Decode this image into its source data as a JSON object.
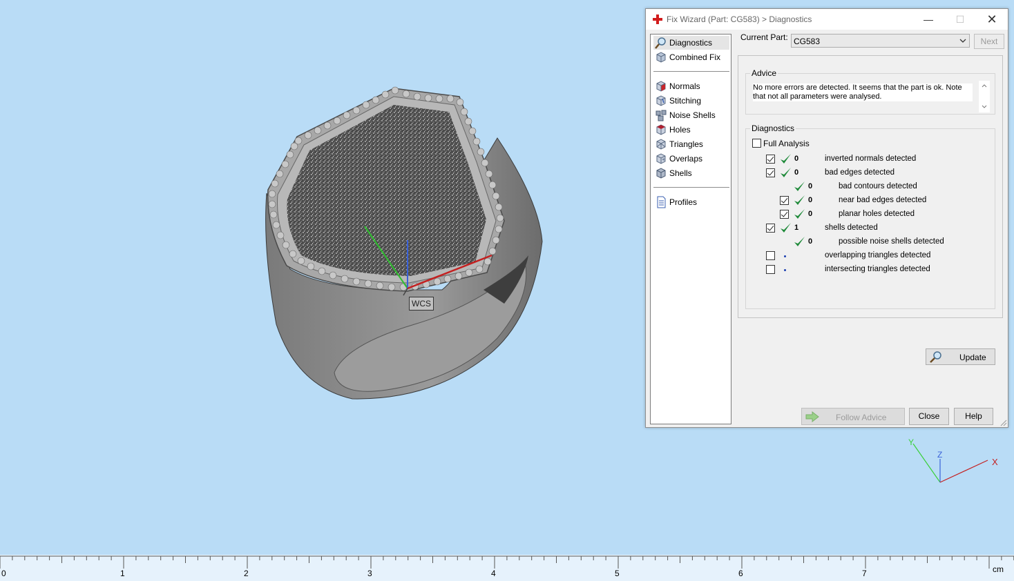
{
  "window": {
    "title": "Fix Wizard (Part: CG583) > Diagnostics",
    "minimize_icon": "minimize-icon",
    "maximize_icon": "maximize-icon",
    "close_icon": "close-icon"
  },
  "nav": {
    "items": [
      {
        "label": "Diagnostics",
        "icon": "magnifier-icon",
        "selected": true
      },
      {
        "label": "Combined Fix",
        "icon": "cube-icon"
      },
      {
        "label": "Normals",
        "icon": "normals-cube-icon"
      },
      {
        "label": "Stitching",
        "icon": "stitching-cube-icon"
      },
      {
        "label": "Noise Shells",
        "icon": "noise-shells-icon"
      },
      {
        "label": "Holes",
        "icon": "holes-cube-icon"
      },
      {
        "label": "Triangles",
        "icon": "triangles-cube-icon"
      },
      {
        "label": "Overlaps",
        "icon": "overlaps-cube-icon"
      },
      {
        "label": "Shells",
        "icon": "shells-cube-icon"
      },
      {
        "label": "Profiles",
        "icon": "document-icon"
      }
    ]
  },
  "current_part": {
    "label": "Current Part:",
    "value": "CG583",
    "next_label": "Next"
  },
  "advice": {
    "title": "Advice",
    "text": "No more errors are detected. It seems that the part is ok. Note that not all parameters were analysed."
  },
  "diagnostics": {
    "title": "Diagnostics",
    "full_analysis_label": "Full Analysis",
    "full_analysis_checked": false,
    "rows": [
      {
        "checkbox": true,
        "checked": true,
        "status": "ok",
        "count": "0",
        "label": "inverted normals detected",
        "indent": 0
      },
      {
        "checkbox": true,
        "checked": true,
        "status": "ok",
        "count": "0",
        "label": "bad edges detected",
        "indent": 0
      },
      {
        "checkbox": false,
        "checked": false,
        "status": "ok",
        "count": "0",
        "label": "bad contours detected",
        "indent": 1
      },
      {
        "checkbox": true,
        "checked": true,
        "status": "ok",
        "count": "0",
        "label": "near bad edges detected",
        "indent": 1
      },
      {
        "checkbox": true,
        "checked": true,
        "status": "ok",
        "count": "0",
        "label": "planar holes detected",
        "indent": 1
      },
      {
        "checkbox": true,
        "checked": true,
        "status": "ok",
        "count": "1",
        "label": "shells detected",
        "indent": 0
      },
      {
        "checkbox": false,
        "checked": false,
        "status": "ok",
        "count": "0",
        "label": "possible noise shells detected",
        "indent": 1
      },
      {
        "checkbox": true,
        "checked": false,
        "status": "pending",
        "count": "",
        "label": "overlapping triangles detected",
        "indent": 0
      },
      {
        "checkbox": true,
        "checked": false,
        "status": "pending",
        "count": "",
        "label": "intersecting triangles detected",
        "indent": 0
      }
    ],
    "update_label": "Update"
  },
  "footer": {
    "follow_advice_label": "Follow Advice",
    "close_label": "Close",
    "help_label": "Help"
  },
  "viewport": {
    "wcs_label": "WCS",
    "axis_x": "X",
    "axis_y": "Y",
    "axis_z": "Z",
    "background_color": "#b9dcf6"
  },
  "ruler": {
    "labels": [
      "0",
      "1",
      "2",
      "3",
      "4",
      "5",
      "6",
      "7"
    ],
    "unit": "cm"
  }
}
